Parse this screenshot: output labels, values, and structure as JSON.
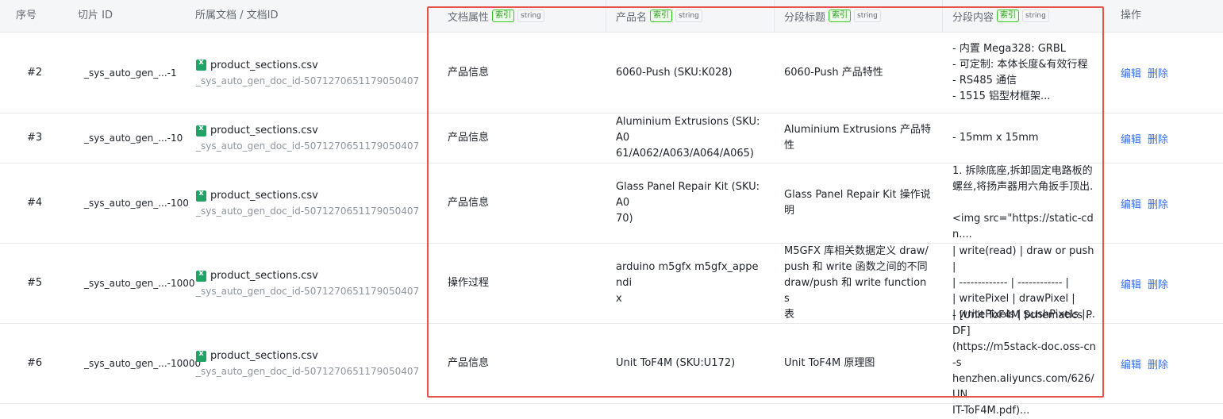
{
  "header": {
    "seq": "序号",
    "chunk_id": "切片 ID",
    "doc": "所属文档 / 文档ID",
    "doc_attr": "文档属性",
    "product_name": "产品名",
    "section_title": "分段标题",
    "section_content": "分段内容",
    "actions": "操作",
    "index_tag": "索引",
    "type_tag": "string"
  },
  "rows": [
    {
      "seq": "#2",
      "chunk_id": "_sys_auto_gen_...-1",
      "doc_name": "product_sections.csv",
      "doc_id": "_sys_auto_gen_doc_id-5071270651179050407",
      "doc_attr": "产品信息",
      "product_name": "6060-Push (SKU:K028)",
      "section_title": "6060-Push 产品特性",
      "section_content": "- 内置 Mega328: GRBL\n- 可定制: 本体长度&有效行程\n- RS485 通信\n- 1515 铝型材框架..."
    },
    {
      "seq": "#3",
      "chunk_id": "_sys_auto_gen_...-10",
      "doc_name": "product_sections.csv",
      "doc_id": "_sys_auto_gen_doc_id-5071270651179050407",
      "doc_attr": "产品信息",
      "product_name": "Aluminium Extrusions (SKU:A0\n61/A062/A063/A064/A065)",
      "section_title": "Aluminium Extrusions 产品特\n性",
      "section_content": "- 15mm x 15mm"
    },
    {
      "seq": "#4",
      "chunk_id": "_sys_auto_gen_...-100",
      "doc_name": "product_sections.csv",
      "doc_id": "_sys_auto_gen_doc_id-5071270651179050407",
      "doc_attr": "产品信息",
      "product_name": "Glass Panel Repair Kit (SKU:A0\n70)",
      "section_title": "Glass Panel Repair Kit 操作说\n明",
      "section_content": "1. 拆除底座,拆卸固定电路板的\n螺丝,将扬声器用六角扳手顶出.\n\n<img src=\"https://static-cdn...."
    },
    {
      "seq": "#5",
      "chunk_id": "_sys_auto_gen_...-1000",
      "doc_name": "product_sections.csv",
      "doc_id": "_sys_auto_gen_doc_id-5071270651179050407",
      "doc_attr": "操作过程",
      "product_name": "arduino m5gfx m5gfx_appendi\nx",
      "section_title": "M5GFX 库相关数据定义 draw/\npush 和 write 函数之间的不同\ndraw/push 和 write functions\n表",
      "section_content": "| write(read) | draw or push |\n| ------------- | ------------ |\n| writePixel | drawPixel |\n| writePixels | pushPixels |..."
    },
    {
      "seq": "#6",
      "chunk_id": "_sys_auto_gen_...-10000",
      "doc_name": "product_sections.csv",
      "doc_id": "_sys_auto_gen_doc_id-5071270651179050407",
      "doc_attr": "产品信息",
      "product_name": "Unit ToF4M (SKU:U172)",
      "section_title": "Unit ToF4M 原理图",
      "section_content": "- [Unit ToF4M Schematics PDF]\n(https://m5stack-doc.oss-cn-s\nhenzhen.aliyuncs.com/626/UN\nIT-ToF4M.pdf)..."
    }
  ],
  "actions": {
    "edit": "编辑",
    "delete": "删除"
  },
  "icons": {
    "doc_file": "excel-file-icon"
  },
  "colors": {
    "highlight": "#e5534b",
    "link": "#3370ff",
    "index_tag": "#2ea121",
    "excel": "#21a366"
  }
}
